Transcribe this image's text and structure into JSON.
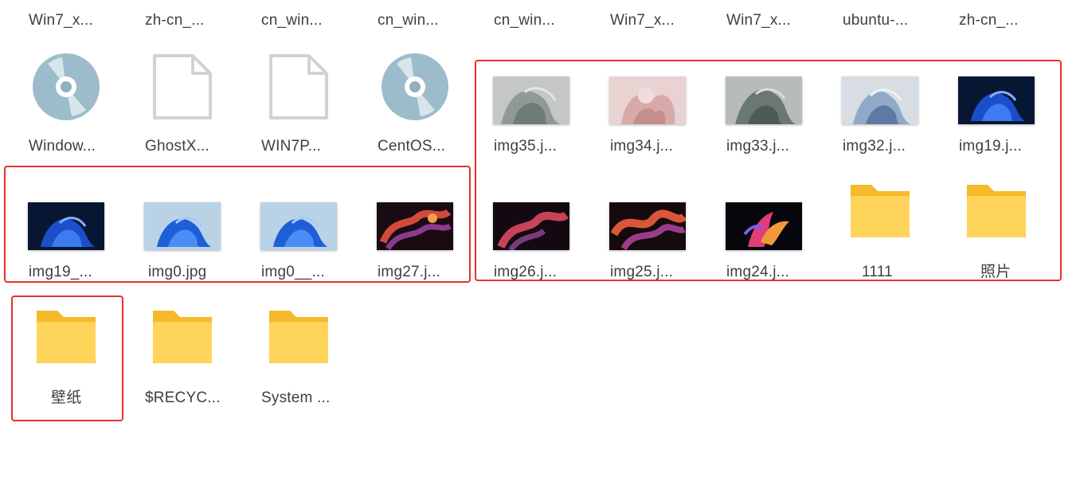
{
  "rows": {
    "row1": [
      "Win7_x...",
      "zh-cn_...",
      "cn_win...",
      "cn_win...",
      "cn_win...",
      "Win7_x...",
      "Win7_x...",
      "ubuntu-...",
      "zh-cn_..."
    ],
    "row2": [
      "Window...",
      "GhostX...",
      "WIN7P...",
      "CentOS...",
      "img35.j...",
      "img34.j...",
      "img33.j...",
      "img32.j...",
      "img19.j..."
    ],
    "row3": [
      "img19_...",
      "img0.jpg",
      "img0__...",
      "img27.j...",
      "img26.j...",
      "img25.j...",
      "img24.j...",
      "1111",
      "照片"
    ],
    "row4": [
      "壁纸",
      "$RECYC...",
      "System ..."
    ]
  },
  "icons": {
    "row2": [
      "disc-icon",
      "document-icon",
      "document-icon",
      "disc-icon",
      "image-thumbnail",
      "image-thumbnail",
      "image-thumbnail",
      "image-thumbnail",
      "image-thumbnail"
    ],
    "row3": [
      "image-thumbnail",
      "image-thumbnail",
      "image-thumbnail",
      "image-thumbnail",
      "image-thumbnail",
      "image-thumbnail",
      "image-thumbnail",
      "folder-icon",
      "folder-icon"
    ],
    "row4": [
      "folder-icon",
      "folder-icon",
      "folder-icon"
    ]
  },
  "colors": {
    "highlight": "#e5322d",
    "folder_front": "#ffd45a",
    "folder_back": "#f6b929",
    "disc": "#9cbccb",
    "label_text": "#3b3f48"
  }
}
